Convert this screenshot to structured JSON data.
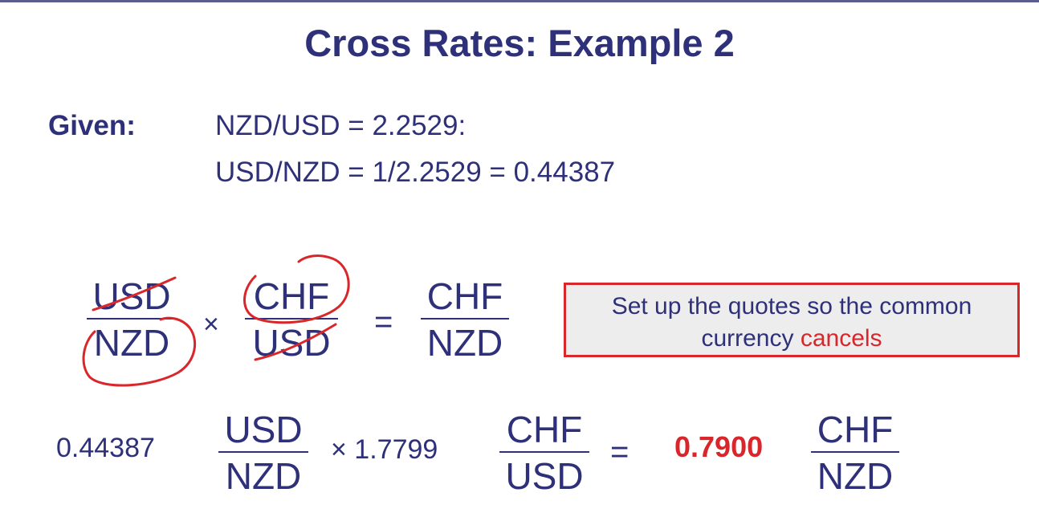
{
  "title": "Cross Rates: Example 2",
  "given": {
    "label": "Given:",
    "line1": "NZD/USD = 2.2529:",
    "line2": "USD/NZD = 1/2.2529 = 0.44387"
  },
  "setup": {
    "f1_num": "USD",
    "f1_den": "NZD",
    "times": "×",
    "f2_num": "CHF",
    "f2_den": "USD",
    "equals": "=",
    "f3_num": "CHF",
    "f3_den": "NZD"
  },
  "callout": {
    "text_before": "Set up the quotes so the common currency ",
    "text_highlight": "cancels"
  },
  "calc": {
    "v1": "0.44387",
    "f1_num": "USD",
    "f1_den": "NZD",
    "times_v2": "× 1.7799",
    "f2_num": "CHF",
    "f2_den": "USD",
    "equals": "=",
    "result": "0.7900",
    "f3_num": "CHF",
    "f3_den": "NZD"
  },
  "colors": {
    "navy": "#2e3079",
    "accent_red": "#d8262b",
    "callout_bg": "#ededed"
  }
}
